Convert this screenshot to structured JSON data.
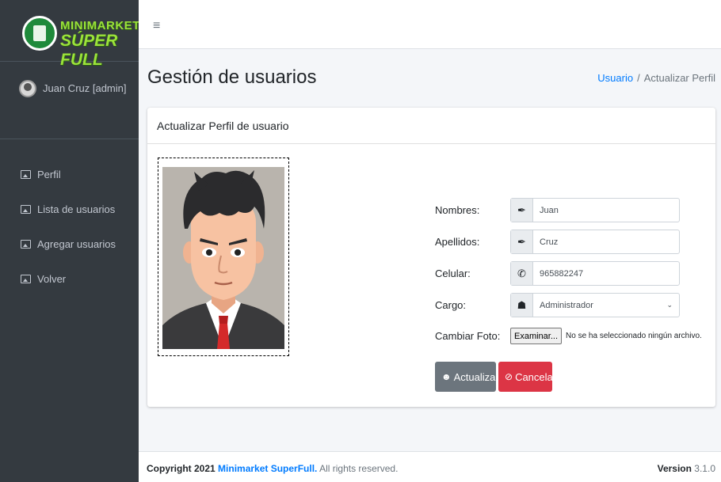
{
  "brand": {
    "line1": "MINIMARKET",
    "line2": "SÚPER FULL"
  },
  "user": {
    "name": "Juan Cruz [admin]"
  },
  "sidebar": {
    "items": [
      {
        "label": "Perfil",
        "icon": "image-icon"
      },
      {
        "label": "Lista de usuarios",
        "icon": "image-icon"
      },
      {
        "label": "Agregar usuarios",
        "icon": "image-icon"
      },
      {
        "label": "Volver",
        "icon": "image-icon"
      }
    ]
  },
  "topbar": {
    "menu_icon": "≡"
  },
  "header": {
    "title": "Gestión de usuarios",
    "breadcrumb": {
      "link": "Usuario",
      "separator": "/",
      "current": "Actualizar Perfil"
    }
  },
  "card": {
    "title": "Actualizar Perfil de usuario",
    "form": {
      "nombres": {
        "label": "Nombres:",
        "value": "Juan",
        "icon": "pen-icon"
      },
      "apellidos": {
        "label": "Apellidos:",
        "value": "Cruz",
        "icon": "pen-icon"
      },
      "celular": {
        "label": "Celular:",
        "value": "965882247",
        "icon": "phone-icon"
      },
      "cargo": {
        "label": "Cargo:",
        "value": "Administrador",
        "icon": "user-group-icon"
      },
      "foto": {
        "label": "Cambiar Foto:",
        "button": "Examinar...",
        "status": "No se ha seleccionado ningún archivo."
      }
    },
    "buttons": {
      "update": "Actualizar",
      "cancel": "Cancelar"
    }
  },
  "footer": {
    "copyright_prefix": "Copyright 2021 ",
    "brand_link": "Minimarket SuperFull.",
    "rights": " All rights reserved.",
    "version_label": "Version",
    "version_value": " 3.1.0"
  },
  "colors": {
    "sidebar_bg": "#343a40",
    "brand_green": "#9be23a",
    "link_blue": "#007bff",
    "update_button": "#6c757d",
    "cancel_button": "#dc3545"
  }
}
